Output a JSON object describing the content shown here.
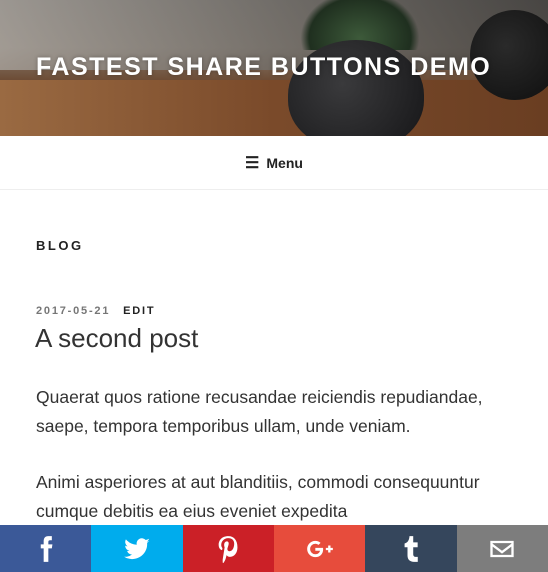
{
  "header": {
    "site_title": "FASTEST SHARE BUTTONS DEMO"
  },
  "nav": {
    "menu_icon": "hamburger-icon",
    "menu_label": "Menu"
  },
  "page": {
    "heading": "BLOG"
  },
  "post": {
    "date": "2017-05-21",
    "edit": "EDIT",
    "title": "A second post",
    "paragraphs": [
      "Quaerat quos ratione recusandae reiciendis repudiandae, saepe, tempora temporibus ullam, unde veniam.",
      "Animi asperiores at aut blanditiis, commodi consequuntur cumque debitis ea eius eveniet expedita"
    ]
  },
  "share_bar": [
    {
      "name": "facebook",
      "icon": "facebook-icon",
      "color": "#3b5998"
    },
    {
      "name": "twitter",
      "icon": "twitter-icon",
      "color": "#00aced"
    },
    {
      "name": "pinterest",
      "icon": "pinterest-icon",
      "color": "#cb2027"
    },
    {
      "name": "google-plus",
      "icon": "google-plus-icon",
      "color": "#e74c3c"
    },
    {
      "name": "tumblr",
      "icon": "tumblr-icon",
      "color": "#35465c"
    },
    {
      "name": "email",
      "icon": "email-icon",
      "color": "#7d7d7d"
    }
  ]
}
